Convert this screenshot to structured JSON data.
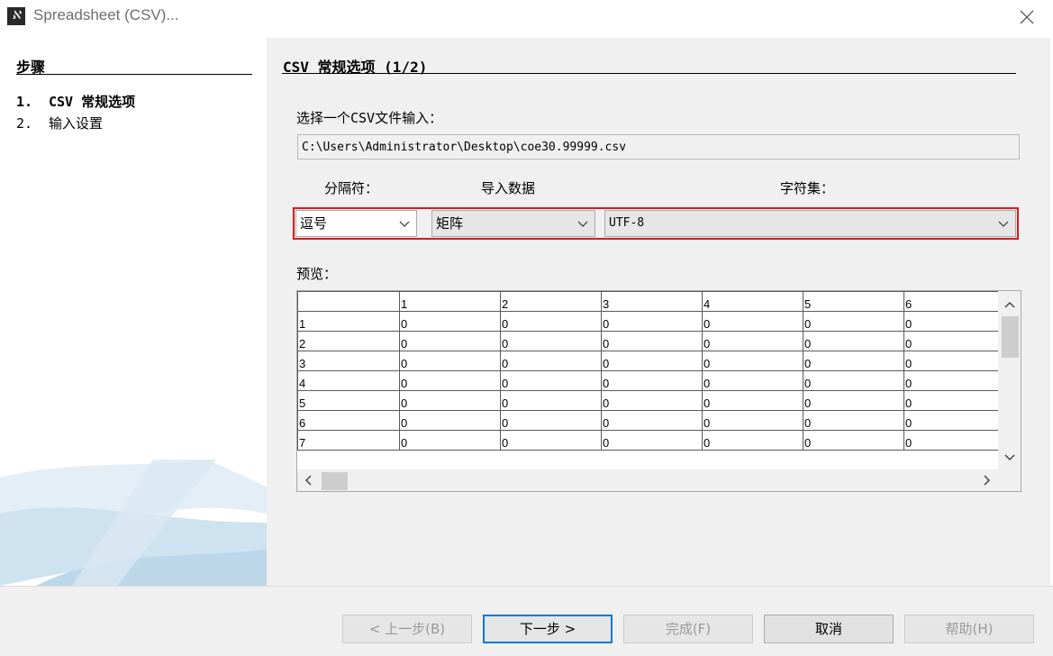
{
  "window": {
    "title": "Spreadsheet (CSV)..."
  },
  "steps": {
    "heading": "步骤",
    "items": [
      {
        "num": "1.",
        "label": "CSV 常规选项",
        "active": true
      },
      {
        "num": "2.",
        "label": "输入设置",
        "active": false
      }
    ]
  },
  "page": {
    "title": "CSV 常规选项 (1/2)",
    "file_label": "选择一个CSV文件输入：",
    "file_path": "C:\\Users\\Administrator\\Desktop\\coe30.99999.csv",
    "separator_label": "分隔符：",
    "import_label": "导入数据",
    "charset_label": "字符集：",
    "separator_value": "逗号",
    "import_value": "矩阵",
    "charset_value": "UTF-8",
    "preview_label": "预览："
  },
  "preview": {
    "columns": [
      "",
      "1",
      "2",
      "3",
      "4",
      "5",
      "6"
    ],
    "rows": [
      [
        "1",
        "0",
        "0",
        "0",
        "0",
        "0",
        "0"
      ],
      [
        "2",
        "0",
        "0",
        "0",
        "0",
        "0",
        "0"
      ],
      [
        "3",
        "0",
        "0",
        "0",
        "0",
        "0",
        "0"
      ],
      [
        "4",
        "0",
        "0",
        "0",
        "0",
        "0",
        "0"
      ],
      [
        "5",
        "0",
        "0",
        "0",
        "0",
        "0",
        "0"
      ],
      [
        "6",
        "0",
        "0",
        "0",
        "0",
        "0",
        "0"
      ],
      [
        "7",
        "0",
        "0",
        "0",
        "0",
        "0",
        "0"
      ]
    ]
  },
  "buttons": {
    "back": "< 上一步(B)",
    "next": "下一步 >",
    "finish": "完成(F)",
    "cancel": "取消",
    "help": "帮助(H)"
  },
  "colors": {
    "highlight": "#e0161b",
    "accent": "#0078d7"
  },
  "icons": [
    "app-icon",
    "close-icon",
    "chevron-down-icon",
    "scroll-up-icon",
    "scroll-down-icon",
    "scroll-left-icon",
    "scroll-right-icon"
  ]
}
